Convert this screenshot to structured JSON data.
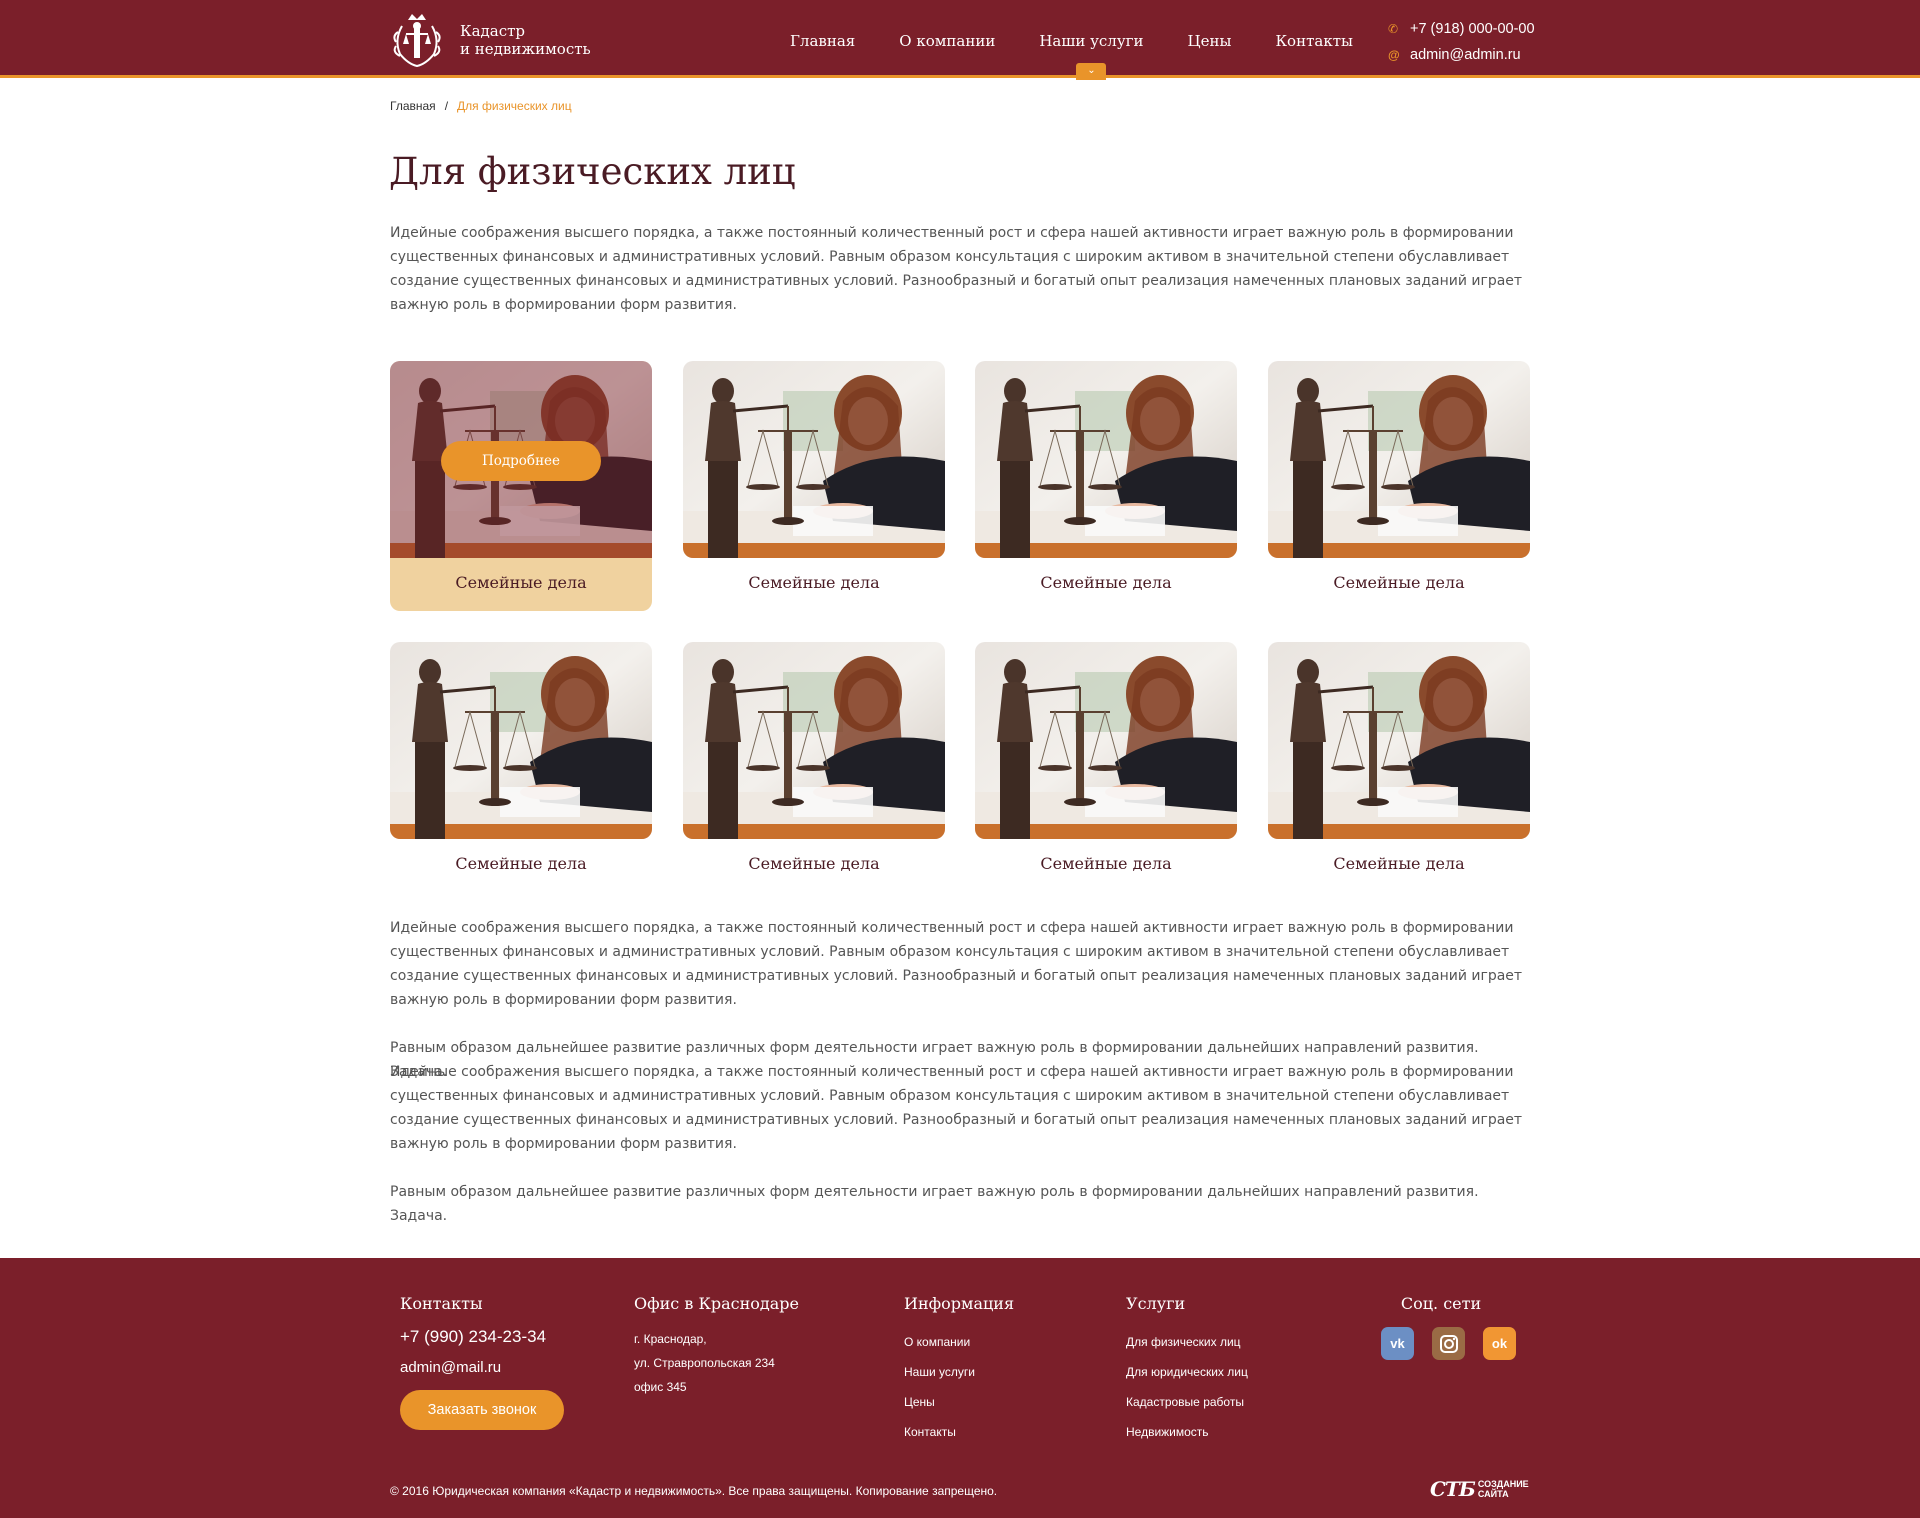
{
  "colors": {
    "brand": "#7b1f2a",
    "accent": "#e9942a",
    "card_active": "#f0d29f"
  },
  "header": {
    "logo_line1": "Кадастр",
    "logo_line2": "и недвижимость",
    "nav": [
      "Главная",
      "О компании",
      "Наши услуги",
      "Цены",
      "Контакты"
    ],
    "active_nav": "Наши услуги",
    "phone": "+7 (918) 000-00-00",
    "email": "admin@admin.ru"
  },
  "breadcrumb": {
    "home": "Главная",
    "separator": "/",
    "current": "Для физических лиц"
  },
  "page_title": "Для физических лиц",
  "intro": "Идейные соображения высшего порядка, а также постоянный количественный рост и сфера нашей активности играет важную роль в формировании существенных финансовых и административных условий. Равным образом консультация с широким активом в значительной степени обуславливает создание существенных финансовых и административных условий. Разнообразный и богатый опыт реализация намеченных плановых заданий играет важную роль в формировании форм развития.",
  "cards": {
    "more_label": "Подробнее",
    "items": [
      "Семейные дела",
      "Семейные дела",
      "Семейные дела",
      "Семейные дела",
      "Семейные дела",
      "Семейные дела",
      "Семейные дела",
      "Семейные дела"
    ]
  },
  "body_text": {
    "p1": "Идейные соображения высшего порядка, а также постоянный количественный рост и сфера нашей активности играет важную роль в формировании существенных финансовых и административных условий. Равным образом консультация с широким активом в значительной степени обуславливает создание существенных финансовых и административных условий. Разнообразный и богатый опыт реализация намеченных плановых заданий играет важную роль в формировании форм развития.",
    "p2a": "Равным образом дальнейшее развитие различных форм деятельности играет важную роль в формировании дальнейших направлений развития. Задача.",
    "p2b": "Идейные соображения высшего порядка, а также постоянный количественный рост и сфера нашей активности играет важную роль в формировании существенных финансовых и административных условий. Равным образом консультация с широким активом в значительной степени обуславливает создание существенных финансовых и административных условий. Разнообразный и богатый опыт реализация намеченных плановых заданий играет важную роль в формировании форм развития.",
    "p3": "Равным образом дальнейшее развитие различных форм деятельности играет важную роль в формировании дальнейших направлений развития. Задача."
  },
  "footer": {
    "contacts": {
      "title": "Контакты",
      "phone": "+7 (990)  234-23-34",
      "email": "admin@mail.ru",
      "button": "Заказать звонок"
    },
    "office": {
      "title": "Офис в Краснодаре",
      "city": "г. Краснодар,",
      "street": "ул. Стравропольская 234",
      "office": "офис 345"
    },
    "info": {
      "title": "Информация",
      "links": [
        "О компании",
        "Наши услуги",
        "Цены",
        "Контакты"
      ]
    },
    "services": {
      "title": "Услуги",
      "links": [
        "Для физических лиц",
        "Для юридических лиц",
        "Кадастровые работы",
        "Недвижимость"
      ]
    },
    "social": {
      "title": "Соц. сети",
      "icons": [
        "vk-icon",
        "instagram-icon",
        "odnoklassniki-icon"
      ],
      "vk_glyph": "vk",
      "ok_glyph": "ok"
    },
    "copyright": "© 2016 Юридическая компания «Кадастр и недвижимость». Все права защищены. Копирование запрещено.",
    "maker_logo": "СТБ",
    "maker_text1": "СОЗДАНИЕ",
    "maker_text2": "САЙТА"
  }
}
